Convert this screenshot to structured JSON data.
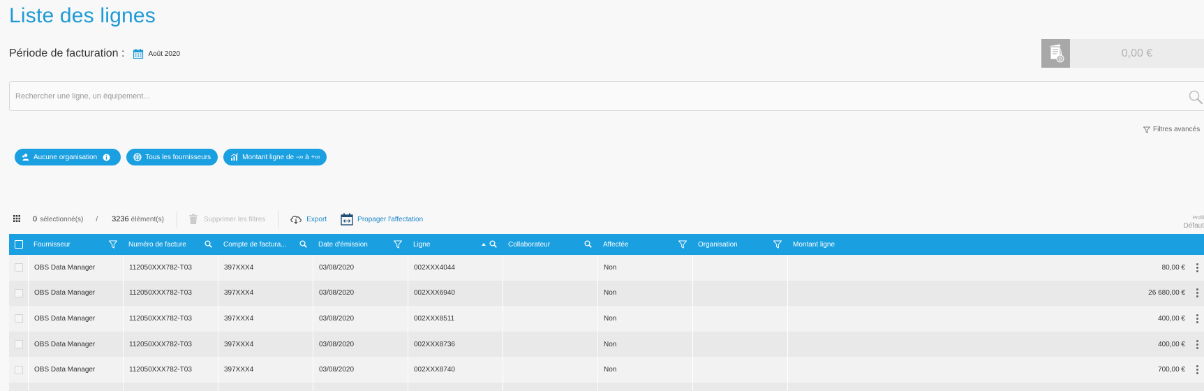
{
  "page": {
    "title": "Liste des lignes"
  },
  "period": {
    "label": "Période de facturation :",
    "value": "Août 2020",
    "icon": "calendar-icon"
  },
  "summary": {
    "amount": "0,00 €",
    "icon": "invoices-icon",
    "badge": "0"
  },
  "search": {
    "placeholder": "Rechercher une ligne, un équipement...",
    "icon": "search-icon"
  },
  "advanced_filters": {
    "label": "Filtres avancés"
  },
  "chips": [
    {
      "label": "Aucune organisation",
      "icon": "organization-icon",
      "has_info": true
    },
    {
      "label": "Tous les fournisseurs",
      "icon": "suppliers-icon",
      "has_info": false
    },
    {
      "label": "Montant ligne de -∞ à +∞",
      "icon": "amount-chart-icon",
      "has_info": false
    }
  ],
  "toolbar": {
    "selected_count": "0",
    "selected_label": "sélectionné(s)",
    "separator": "/",
    "total_count": "3236",
    "total_label": "élément(s)",
    "clear_filters": "Supprimer les filtres",
    "export": "Export",
    "propagate": "Propager l'affectation",
    "profile_label": "Profil",
    "profile_value": "Défaut"
  },
  "table": {
    "accent": "#1a9fe0",
    "columns": [
      {
        "label": "Fournisseur",
        "icon": "filter"
      },
      {
        "label": "Numéro de facture",
        "icon": "search"
      },
      {
        "label": "Compte de factura...",
        "icon": "search"
      },
      {
        "label": "Date d'émission",
        "icon": "filter"
      },
      {
        "label": "Ligne",
        "icon": "sort-search"
      },
      {
        "label": "Collaborateur",
        "icon": "search"
      },
      {
        "label": "Affectée",
        "icon": "filter"
      },
      {
        "label": "Organisation",
        "icon": "filter"
      },
      {
        "label": "Montant ligne",
        "icon": ""
      }
    ],
    "rows": [
      {
        "fournisseur": "OBS Data Manager",
        "facture": "112050XXX782-T03",
        "compte": "397XXX4",
        "date": "03/08/2020",
        "ligne": "002XXX4044",
        "collaborateur": "",
        "affectee": "Non",
        "organisation": "",
        "montant": "80,00 €"
      },
      {
        "fournisseur": "OBS Data Manager",
        "facture": "112050XXX782-T03",
        "compte": "397XXX4",
        "date": "03/08/2020",
        "ligne": "002XXX6940",
        "collaborateur": "",
        "affectee": "Non",
        "organisation": "",
        "montant": "26 680,00 €"
      },
      {
        "fournisseur": "OBS Data Manager",
        "facture": "112050XXX782-T03",
        "compte": "397XXX4",
        "date": "03/08/2020",
        "ligne": "002XXX8511",
        "collaborateur": "",
        "affectee": "Non",
        "organisation": "",
        "montant": "400,00 €"
      },
      {
        "fournisseur": "OBS Data Manager",
        "facture": "112050XXX782-T03",
        "compte": "397XXX4",
        "date": "03/08/2020",
        "ligne": "002XXX8736",
        "collaborateur": "",
        "affectee": "Non",
        "organisation": "",
        "montant": "400,00 €"
      },
      {
        "fournisseur": "OBS Data Manager",
        "facture": "112050XXX782-T03",
        "compte": "397XXX4",
        "date": "03/08/2020",
        "ligne": "002XXX8740",
        "collaborateur": "",
        "affectee": "Non",
        "organisation": "",
        "montant": "700,00 €"
      }
    ]
  }
}
